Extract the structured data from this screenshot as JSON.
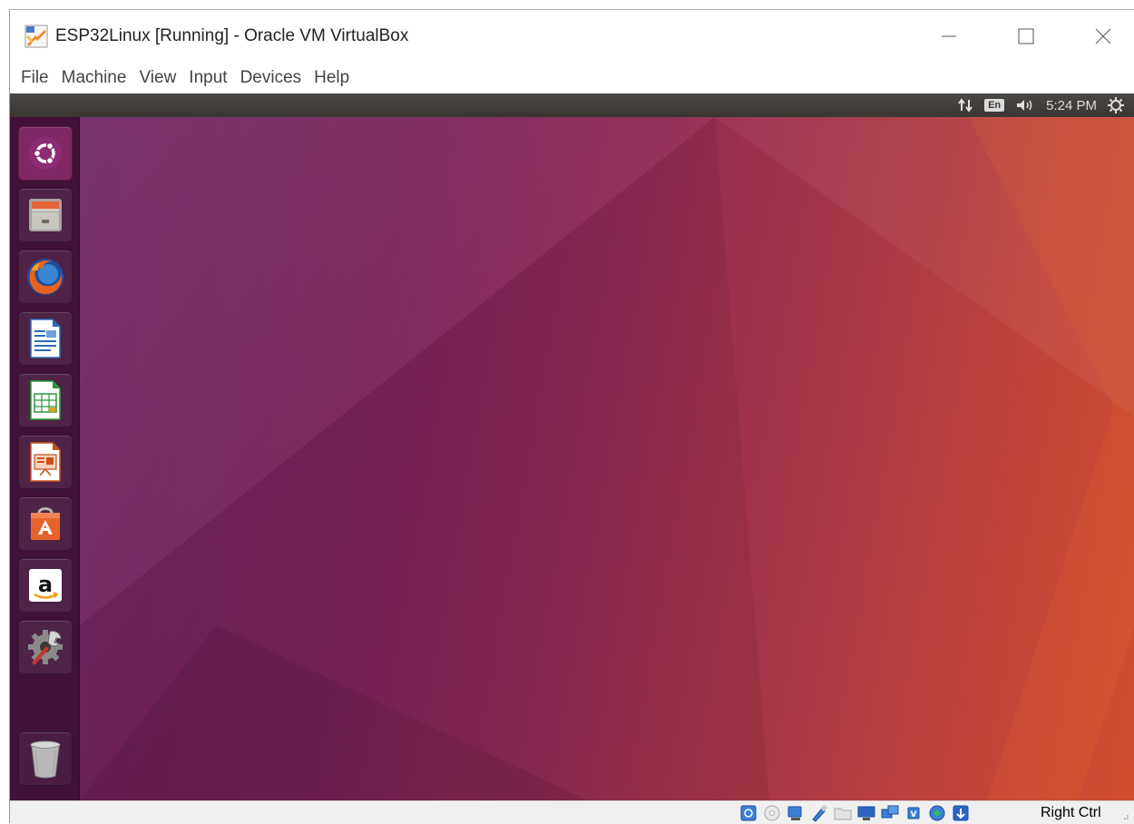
{
  "window": {
    "title": "ESP32Linux [Running] - Oracle VM VirtualBox",
    "app_icon": "virtualbox-icon",
    "buttons": {
      "minimize": "minimize-icon",
      "maximize": "maximize-icon",
      "close": "close-icon"
    }
  },
  "menu": {
    "items": [
      "File",
      "Machine",
      "View",
      "Input",
      "Devices",
      "Help"
    ]
  },
  "guest_topbar": {
    "network_icon": "network-arrows-icon",
    "keyboard_layout": "En",
    "volume_icon": "volume-icon",
    "time": "5:24 PM",
    "system_icon": "power-gear-icon"
  },
  "launcher": {
    "items": [
      {
        "name": "ubuntu-dash",
        "icon": "ubuntu-logo-icon"
      },
      {
        "name": "files",
        "icon": "file-cabinet-icon"
      },
      {
        "name": "firefox",
        "icon": "firefox-icon"
      },
      {
        "name": "libreoffice-writer",
        "icon": "writer-document-icon"
      },
      {
        "name": "libreoffice-calc",
        "icon": "calc-spreadsheet-icon"
      },
      {
        "name": "libreoffice-impress",
        "icon": "impress-presentation-icon"
      },
      {
        "name": "ubuntu-software",
        "icon": "software-bag-icon"
      },
      {
        "name": "amazon",
        "icon": "amazon-icon"
      },
      {
        "name": "system-settings",
        "icon": "settings-tools-icon"
      }
    ],
    "trash_icon": "trash-icon"
  },
  "statusbar": {
    "icons": [
      "hard-disk-icon",
      "optical-drive-icon",
      "audio-icon",
      "usb-pen-icon",
      "shared-folder-icon",
      "display-icon",
      "network-monitor-icon",
      "cpu-icon",
      "recording-icon",
      "mouse-integration-icon"
    ],
    "host_key": "Right Ctrl"
  },
  "colors": {
    "accent_orange": "#dd4814",
    "aubergine": "#5e2750",
    "topbar": "#3c3b37"
  }
}
